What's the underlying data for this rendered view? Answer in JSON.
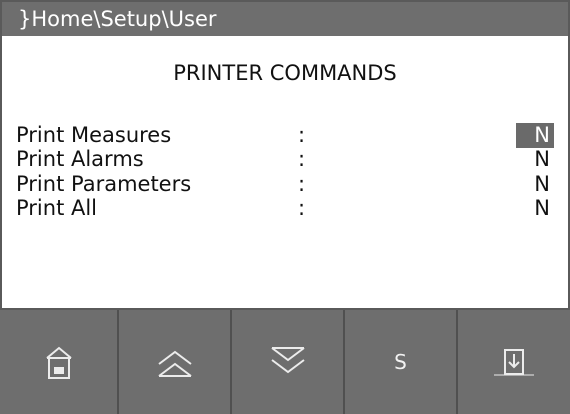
{
  "header": {
    "breadcrumb": "}Home\\Setup\\User"
  },
  "page": {
    "title": "PRINTER COMMANDS"
  },
  "settings": [
    {
      "label": "Print Measures",
      "separator": ":",
      "value": "N",
      "selected": true
    },
    {
      "label": "Print Alarms",
      "separator": ":",
      "value": "N",
      "selected": false
    },
    {
      "label": "Print Parameters",
      "separator": ":",
      "value": "N",
      "selected": false
    },
    {
      "label": "Print All",
      "separator": ":",
      "value": "N",
      "selected": false
    }
  ],
  "toolbar": {
    "home_icon": "home-icon",
    "up_icon": "chevron-up-icon",
    "down_icon": "chevron-down-icon",
    "s_label": "S",
    "exit_icon": "exit-icon"
  },
  "colors": {
    "frame": "#5a5a5a",
    "bar": "#6e6e6e",
    "panel": "#ffffff",
    "selection": "#6a6a6a"
  }
}
